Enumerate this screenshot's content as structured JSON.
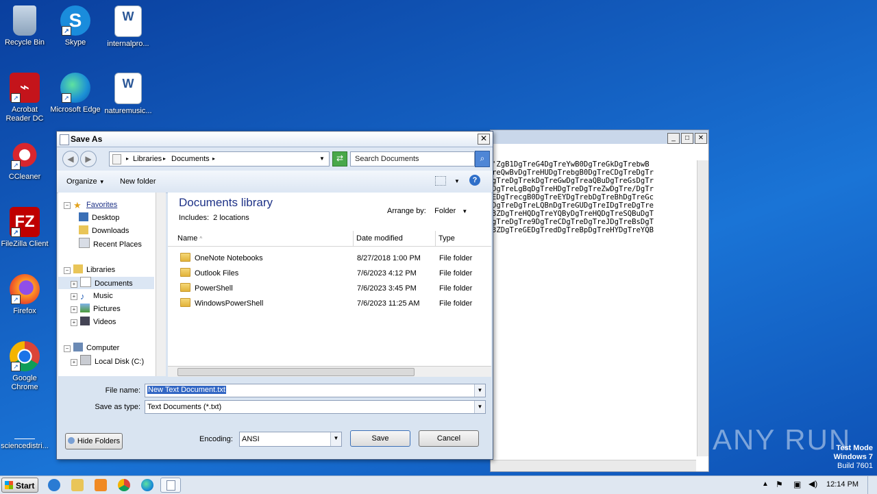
{
  "desktop": {
    "icons": [
      {
        "label": "Recycle Bin"
      },
      {
        "label": "Skype"
      },
      {
        "label": "internalpro..."
      },
      {
        "label": "Acrobat Reader DC"
      },
      {
        "label": "Microsoft Edge"
      },
      {
        "label": "naturemusic..."
      },
      {
        "label": "CCleaner"
      },
      {
        "label": "FileZilla Client"
      },
      {
        "label": "Firefox"
      },
      {
        "label": "Google Chrome"
      },
      {
        "label": "sciencedistri..."
      }
    ]
  },
  "notepad": {
    "content": "'ZgB1DgTreG4DgTreYwB0DgTreGkDgTrebwB\nreQwBvDgTreHUDgTrebgB0DgTreCDgTreDgTr\ngTreDgTrekDgTreGwDgTreaQBuDgTreGsDgTr\nDgTreLgBqDgTreHDgTreDgTreZwDgTre/DgTr\nEDgTrecgB0DgTreEYDgTrebDgTreBhDgTreGc\nDgTreDgTreLQBnDgTreGUDgTreIDgTreDgTre\n3ZDgTreHQDgTreYQByDgTreHQDgTreSQBuDgT\ngTreDgTre9DgTreCDgTreDgTreJDgTreBsDgT\n3ZDgTreGEDgTredDgTreBpDgTreHYDgTreYQB"
  },
  "dialog": {
    "title": "Save As",
    "address": {
      "part1": "Libraries",
      "part2": "Documents"
    },
    "search_placeholder": "Search Documents",
    "toolbar": {
      "organize": "Organize",
      "new_folder": "New folder"
    },
    "tree": {
      "favorites": "Favorites",
      "desktop": "Desktop",
      "downloads": "Downloads",
      "recent": "Recent Places",
      "libraries": "Libraries",
      "documents": "Documents",
      "music": "Music",
      "pictures": "Pictures",
      "videos": "Videos",
      "computer": "Computer",
      "local_disk": "Local Disk (C:)"
    },
    "library": {
      "title": "Documents library",
      "includes_label": "Includes:",
      "includes_link": "2 locations",
      "arrange_label": "Arrange by:",
      "arrange_value": "Folder"
    },
    "columns": {
      "name": "Name",
      "date": "Date modified",
      "type": "Type"
    },
    "files": [
      {
        "name": "OneNote Notebooks",
        "date": "8/27/2018 1:00 PM",
        "type": "File folder"
      },
      {
        "name": "Outlook Files",
        "date": "7/6/2023 4:12 PM",
        "type": "File folder"
      },
      {
        "name": "PowerShell",
        "date": "7/6/2023 3:45 PM",
        "type": "File folder"
      },
      {
        "name": "WindowsPowerShell",
        "date": "7/6/2023 11:25 AM",
        "type": "File folder"
      }
    ],
    "file_name_label": "File name:",
    "file_name_value": "New Text Document.txt",
    "save_type_label": "Save as type:",
    "save_type_value": "Text Documents (*.txt)",
    "hide_folders": "Hide Folders",
    "encoding_label": "Encoding:",
    "encoding_value": "ANSI",
    "save": "Save",
    "cancel": "Cancel"
  },
  "watermark": {
    "brand": "ANY RUN",
    "line1": "Test Mode",
    "line2": "Windows 7",
    "line3": "Build 7601"
  },
  "taskbar": {
    "start": "Start",
    "clock": "12:14 PM"
  }
}
